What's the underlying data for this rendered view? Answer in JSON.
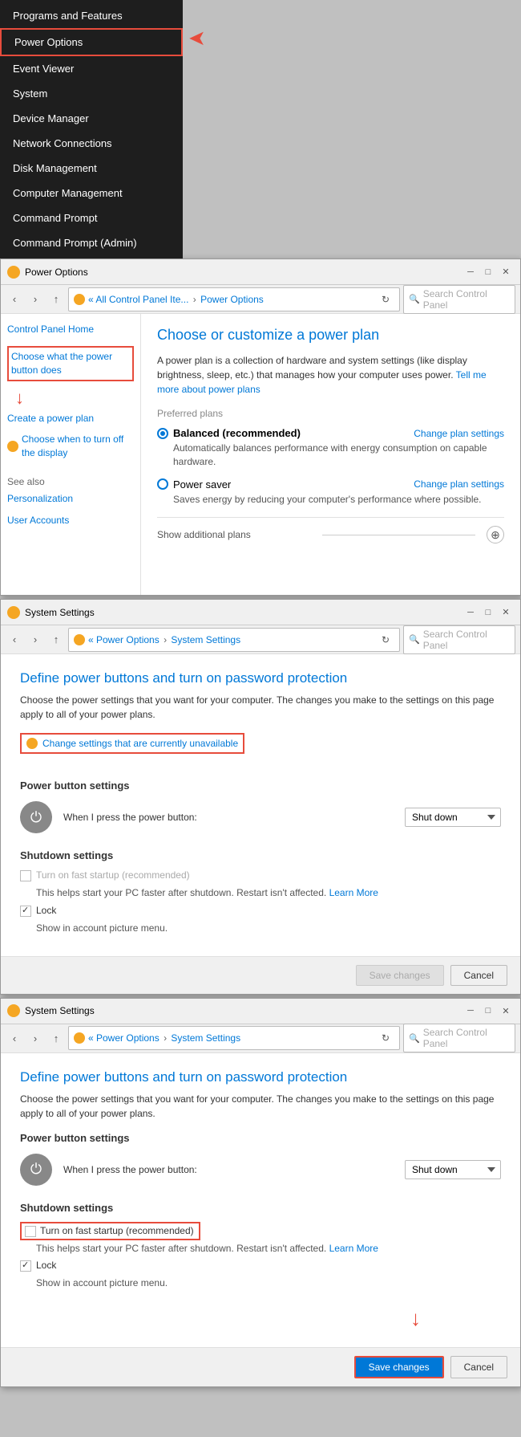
{
  "contextMenu": {
    "items": [
      {
        "label": "Programs and Features",
        "highlighted": false
      },
      {
        "label": "Power Options",
        "highlighted": true
      },
      {
        "label": "Event Viewer",
        "highlighted": false
      },
      {
        "label": "System",
        "highlighted": false
      },
      {
        "label": "Device Manager",
        "highlighted": false
      },
      {
        "label": "Network Connections",
        "highlighted": false
      },
      {
        "label": "Disk Management",
        "highlighted": false
      },
      {
        "label": "Computer Management",
        "highlighted": false
      },
      {
        "label": "Command Prompt",
        "highlighted": false
      },
      {
        "label": "Command Prompt (Admin)",
        "highlighted": false
      }
    ]
  },
  "powerOptionsWindow": {
    "title": "Power Options",
    "addressPath": "« All Control Panel Ite... › Power Options",
    "searchPlaceholder": "Search Control Panel",
    "sidebarHome": "Control Panel Home",
    "sidebarLinks": [
      {
        "label": "Choose what the power button does",
        "highlighted": true
      },
      {
        "label": "Create a power plan"
      },
      {
        "label": "Choose when to turn off the display"
      }
    ],
    "seeAlso": "See also",
    "seeAlsoLinks": [
      "Personalization",
      "User Accounts"
    ],
    "heading": "Choose or customize a power plan",
    "description": "A power plan is a collection of hardware and system settings (like display brightness, sleep, etc.) that manages how your computer uses power.",
    "tellMeLink": "Tell me more about power plans",
    "preferredPlansLabel": "Preferred plans",
    "plans": [
      {
        "name": "Balanced (recommended)",
        "selected": true,
        "description": "Automatically balances performance with energy consumption on capable hardware.",
        "changeLink": "Change plan settings"
      },
      {
        "name": "Power saver",
        "selected": false,
        "description": "Saves energy by reducing your computer's performance where possible.",
        "changeLink": "Change plan settings"
      }
    ],
    "showAdditional": "Show additional plans"
  },
  "systemSettingsWindow1": {
    "title": "System Settings",
    "addressPath": "« Power Options › System Settings",
    "searchPlaceholder": "Search Control Panel",
    "heading": "Define power buttons and turn on password protection",
    "description": "Choose the power settings that you want for your computer. The changes you make to the settings on this page apply to all of your power plans.",
    "changeSettingsLink": "Change settings that are currently unavailable",
    "powerButtonSection": "Power button settings",
    "powerButtonLabel": "When I press the power button:",
    "powerButtonValue": "Shut down",
    "shutdownSection": "Shutdown settings",
    "fastStartupLabel": "Turn on fast startup (recommended)",
    "fastStartupChecked": false,
    "fastStartupDesc": "This helps start your PC faster after shutdown. Restart isn't affected.",
    "learnMoreLink": "Learn More",
    "lockLabel": "Lock",
    "lockChecked": true,
    "lockDesc": "Show in account picture menu.",
    "saveLabel": "Save changes",
    "cancelLabel": "Cancel",
    "saveDisabled": true
  },
  "systemSettingsWindow2": {
    "title": "System Settings",
    "addressPath": "« Power Options › System Settings",
    "searchPlaceholder": "Search Control Panel",
    "heading": "Define power buttons and turn on password protection",
    "description": "Choose the power settings that you want for your computer. The changes you make to the settings on this page apply to all of your power plans.",
    "powerButtonSection": "Power button settings",
    "powerButtonLabel": "When I press the power button:",
    "powerButtonValue": "Shut down",
    "shutdownSection": "Shutdown settings",
    "fastStartupLabel": "Turn on fast startup (recommended)",
    "fastStartupChecked": false,
    "fastStartupDesc": "This helps start your PC faster after shutdown. Restart isn't affected.",
    "learnMoreLink": "Learn More",
    "lockLabel": "Lock",
    "lockChecked": true,
    "lockDesc": "Show in account picture menu.",
    "saveLabel": "Save changes",
    "cancelLabel": "Cancel",
    "saveDisabled": false
  }
}
